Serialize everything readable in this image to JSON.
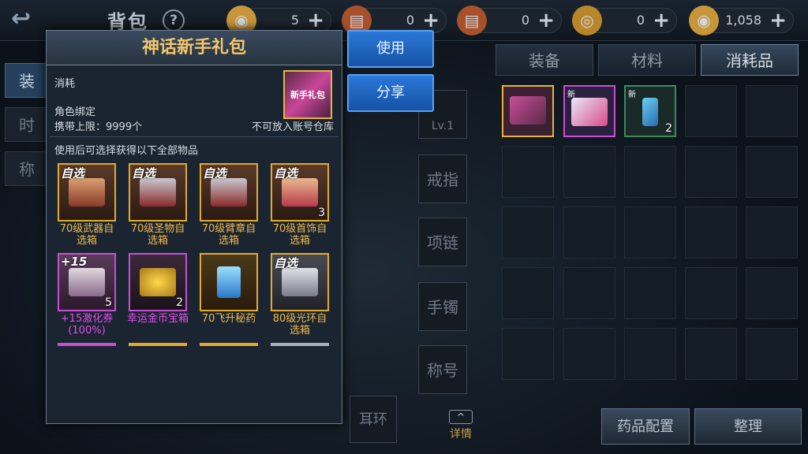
{
  "header": {
    "title": "背包",
    "help": "?",
    "back": "↩"
  },
  "currencies": [
    {
      "value": "5",
      "icon": "coin-icon",
      "color": "#c8963a"
    },
    {
      "value": "0",
      "icon": "scroll-icon",
      "color": "#c0622a"
    },
    {
      "value": "0",
      "icon": "locked-scroll-icon",
      "color": "#c0622a"
    },
    {
      "value": "0",
      "icon": "medal-icon",
      "color": "#c8963a"
    },
    {
      "value": "1,058",
      "icon": "locked-coin-icon",
      "color": "#c8963a"
    }
  ],
  "plus": "+",
  "tabs": [
    {
      "label": "装备"
    },
    {
      "label": "材料"
    },
    {
      "label": "消耗品"
    }
  ],
  "left_nav": [
    {
      "label": "装"
    },
    {
      "label": "时"
    },
    {
      "label": "称"
    }
  ],
  "equip_slots": [
    {
      "label": "Lv.1"
    },
    {
      "label": "戒指"
    },
    {
      "label": "项链"
    },
    {
      "label": "手镯"
    },
    {
      "label": "称号"
    }
  ],
  "earring": "耳环",
  "details": "详情",
  "chevron": "^",
  "bottom_buttons": [
    {
      "label": "药品配置"
    },
    {
      "label": "整理"
    }
  ],
  "inventory": [
    {
      "badge": "",
      "count": "",
      "color": "#e8b33a"
    },
    {
      "badge": "新",
      "count": "",
      "color": "#c84fd0"
    },
    {
      "badge": "新",
      "count": "2",
      "color": "#3c8c5a"
    }
  ],
  "popup": {
    "title": "神话新手礼包",
    "type": "消耗",
    "bind": "角色绑定",
    "limit": "携带上限：9999个",
    "no_store": "不可放入账号仓库",
    "icon_text": "新手礼包",
    "desc": "使用后可选择获得以下全部物品",
    "rewards": [
      {
        "name": "70级武器自选箱",
        "tag": "自选",
        "count": "",
        "tier": "gold"
      },
      {
        "name": "70级圣物自选箱",
        "tag": "自选",
        "count": "",
        "tier": "gold"
      },
      {
        "name": "70级臂章自选箱",
        "tag": "自选",
        "count": "",
        "tier": "gold"
      },
      {
        "name": "70级首饰自选箱",
        "tag": "自选",
        "count": "3",
        "tier": "gold"
      },
      {
        "name": "+15激化券(100%)",
        "tag": "+15",
        "count": "5",
        "tier": "purple"
      },
      {
        "name": "幸运金币宝箱",
        "tag": "",
        "count": "2",
        "tier": "purple"
      },
      {
        "name": "70飞升秘药",
        "tag": "",
        "count": "",
        "tier": "gold"
      },
      {
        "name": "80级光环自选箱",
        "tag": "自选",
        "count": "",
        "tier": "gold"
      }
    ]
  },
  "actions": {
    "use": "使用",
    "share": "分享"
  }
}
